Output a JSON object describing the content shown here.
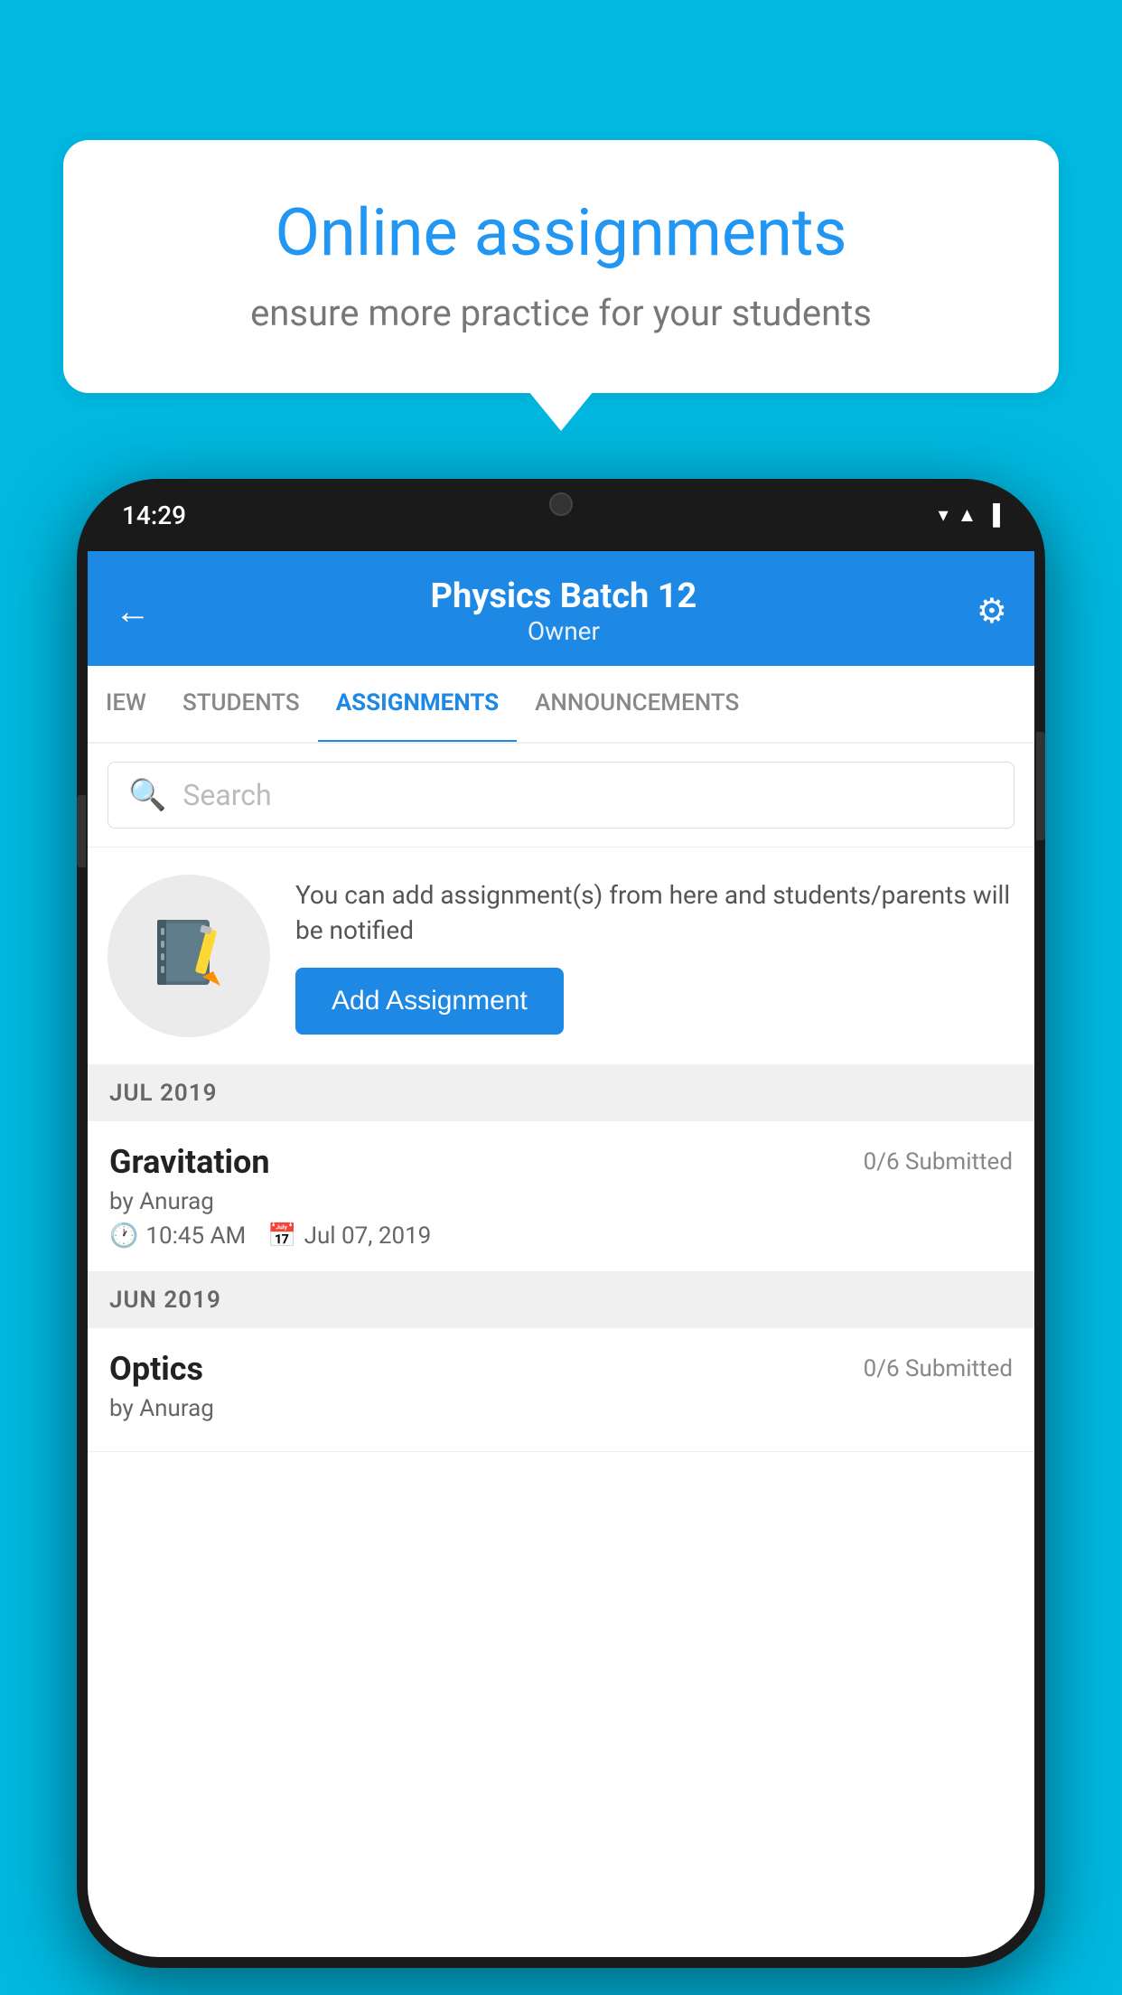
{
  "background": {
    "color": "#00b8e0"
  },
  "speech_bubble": {
    "title": "Online assignments",
    "subtitle": "ensure more practice for your students"
  },
  "phone": {
    "status_bar": {
      "time": "14:29",
      "wifi_icon": "▼",
      "signal_icon": "▲",
      "battery_icon": "▐"
    },
    "header": {
      "back_label": "←",
      "title": "Physics Batch 12",
      "subtitle": "Owner",
      "settings_label": "⚙"
    },
    "tabs": [
      {
        "label": "IEW",
        "active": false
      },
      {
        "label": "STUDENTS",
        "active": false
      },
      {
        "label": "ASSIGNMENTS",
        "active": true
      },
      {
        "label": "ANNOUNCEMENTS",
        "active": false
      }
    ],
    "search": {
      "placeholder": "Search"
    },
    "promo": {
      "text": "You can add assignment(s) from here and students/parents will be notified",
      "button_label": "Add Assignment"
    },
    "sections": [
      {
        "header": "JUL 2019",
        "assignments": [
          {
            "title": "Gravitation",
            "submitted": "0/6 Submitted",
            "author": "by Anurag",
            "time": "10:45 AM",
            "date": "Jul 07, 2019"
          }
        ]
      },
      {
        "header": "JUN 2019",
        "assignments": [
          {
            "title": "Optics",
            "submitted": "0/6 Submitted",
            "author": "by Anurag",
            "time": "",
            "date": ""
          }
        ]
      }
    ]
  }
}
